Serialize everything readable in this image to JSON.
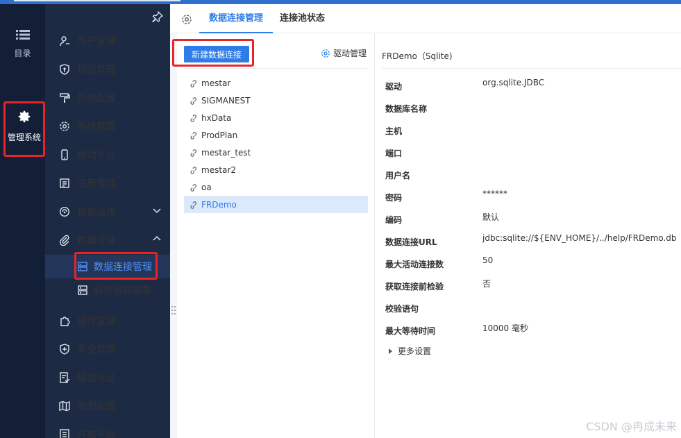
{
  "rail": {
    "catalog_label": "目录",
    "system_label": "管理系统"
  },
  "nav": {
    "items": [
      {
        "label": "用户管理"
      },
      {
        "label": "权限管理"
      },
      {
        "label": "外观配置"
      },
      {
        "label": "系统管理"
      },
      {
        "label": "移动平台"
      },
      {
        "label": "注册管理"
      },
      {
        "label": "智能运维"
      },
      {
        "label": "数据连接"
      },
      {
        "label": "插件管理"
      },
      {
        "label": "安全管理"
      },
      {
        "label": "模板认证"
      },
      {
        "label": "地图配置"
      },
      {
        "label": "开放平台"
      }
    ],
    "sub_items": [
      {
        "label": "数据连接管理"
      },
      {
        "label": "服务器数据集"
      }
    ]
  },
  "tabs": [
    {
      "label": "数据连接管理"
    },
    {
      "label": "连接池状态"
    }
  ],
  "toolbar": {
    "new_label": "新建数据连接",
    "driver_label": "驱动管理"
  },
  "connections": [
    "mestar",
    "SIGMANEST",
    "hxData",
    "ProdPlan",
    "mestar_test",
    "mestar2",
    "oa",
    "FRDemo"
  ],
  "detail": {
    "title": "FRDemo（Sqlite)",
    "rows": [
      {
        "k": "驱动",
        "v": "org.sqlite.JDBC"
      },
      {
        "k": "数据库名称",
        "v": ""
      },
      {
        "k": "主机",
        "v": ""
      },
      {
        "k": "端口",
        "v": ""
      },
      {
        "k": "用户名",
        "v": ""
      },
      {
        "k": "密码",
        "v": "******"
      },
      {
        "k": "编码",
        "v": "默认"
      },
      {
        "k": "数据连接URL",
        "v": "jdbc:sqlite://${ENV_HOME}/../help/FRDemo.db"
      },
      {
        "k": "最大活动连接数",
        "v": "50"
      },
      {
        "k": "获取连接前检验",
        "v": "否"
      },
      {
        "k": "校验语句",
        "v": ""
      },
      {
        "k": "最大等待时间",
        "v": "10000 毫秒"
      }
    ],
    "more_label": "更多设置"
  },
  "watermark": "CSDN @冉成未来",
  "colors": {
    "accent": "#2f7ce8",
    "highlight_border": "#e8242a",
    "sidebar": "#1d2a44",
    "rail": "#131f36"
  }
}
